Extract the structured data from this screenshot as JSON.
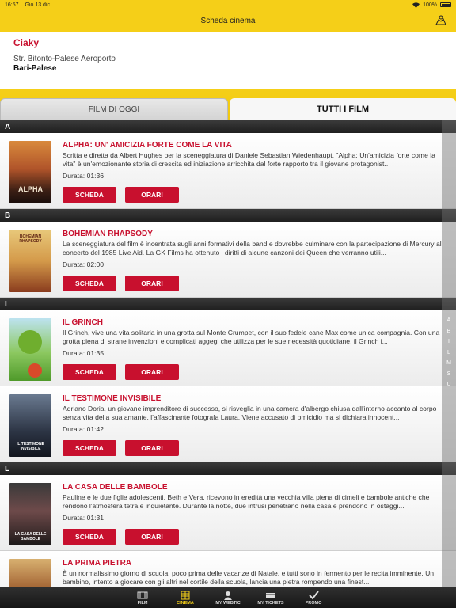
{
  "status_bar": {
    "time": "16:57",
    "date": "Gio 13 dic",
    "battery": "100%"
  },
  "nav": {
    "title": "Scheda cinema"
  },
  "cinema": {
    "name": "Ciaky",
    "address": "Str. Bitonto-Palese Aeroporto",
    "city": "Bari-Palese"
  },
  "tabs": {
    "today": "FILM DI OGGI",
    "all": "TUTTI I FILM"
  },
  "buttons": {
    "scheda": "SCHEDA",
    "orari": "ORARI"
  },
  "duration_label": "Durata:",
  "sections": [
    {
      "letter": "A",
      "movies": [
        {
          "title": "ALPHA: UN' AMICIZIA FORTE COME LA VITA",
          "description": "Scritta e diretta da Albert Hughes per la sceneggiatura di Daniele Sebastian Wiedenhaupt, \"Alpha: Un'amicizia forte come la vita\" è un'emozionante storia di crescita ed iniziazione arricchita dal forte rapporto tra il giovane protagonist...",
          "duration": "01:36",
          "poster_text": "ALPHA"
        }
      ]
    },
    {
      "letter": "B",
      "movies": [
        {
          "title": "BOHEMIAN RHAPSODY",
          "description": "La sceneggiatura del film è incentrata sugli anni formativi della band e dovrebbe culminare con la partecipazione di Mercury al concerto del 1985 Live Aid. La GK Films ha ottenuto i diritti di alcune canzoni dei Queen che verranno utili...",
          "duration": "02:00",
          "poster_text": "BOHEMIAN RHAPSODY"
        }
      ]
    },
    {
      "letter": "I",
      "movies": [
        {
          "title": "IL GRINCH",
          "description": "Il Grinch, vive una vita solitaria in una grotta sul Monte Crumpet, con il suo fedele cane Max come unica compagnia. Con una grotta piena di strane invenzioni e complicati aggegi che utilizza per le sue necessità quotidiane, il Grinch i...",
          "duration": "01:35",
          "poster_text": ""
        },
        {
          "title": "IL TESTIMONE INVISIBILE",
          "description": "Adriano Doria, un giovane imprenditore di successo, si risveglia in una camera d'albergo chiusa dall'interno accanto al corpo senza vita della sua amante, l'affascinante fotografa Laura. Viene accusato di omicidio ma si dichiara innocent...",
          "duration": "01:42",
          "poster_text": "IL TESTIMONE INVISIBILE"
        }
      ]
    },
    {
      "letter": "L",
      "movies": [
        {
          "title": "LA CASA DELLE BAMBOLE",
          "description": "Pauline e le due figlie adolescenti, Beth e Vera, ricevono in eredità una vecchia villa piena di cimeli e bambole antiche che rendono l'atmosfera tetra e inquietante. Durante la notte, due intrusi penetrano nella casa e prendono in ostaggi...",
          "duration": "01:31",
          "poster_text": "LA CASA DELLE BAMBOLE"
        },
        {
          "title": "LA PRIMA PIETRA",
          "description": "È un normalissimo giorno di scuola, poco prima delle vacanze di Natale, e tutti sono in fermento per le recita imminente. Un bambino, intento a giocare con gli altri nel cortile della scuola, lancia una pietra rompendo una finest...",
          "duration": "",
          "poster_text": ""
        }
      ]
    }
  ],
  "index_letters": [
    "A",
    "B",
    "I",
    "L",
    "M",
    "S",
    "U"
  ],
  "tab_bar": [
    {
      "label": "FILM",
      "icon": "film-icon"
    },
    {
      "label": "CINEMA",
      "icon": "cinema-icon",
      "active": true
    },
    {
      "label": "MY WEBTIC",
      "icon": "user-icon"
    },
    {
      "label": "MY TICKETS",
      "icon": "ticket-icon"
    },
    {
      "label": "PROMO",
      "icon": "check-icon"
    }
  ],
  "colors": {
    "brand_yellow": "#f5cf18",
    "accent_red": "#c8102e"
  }
}
